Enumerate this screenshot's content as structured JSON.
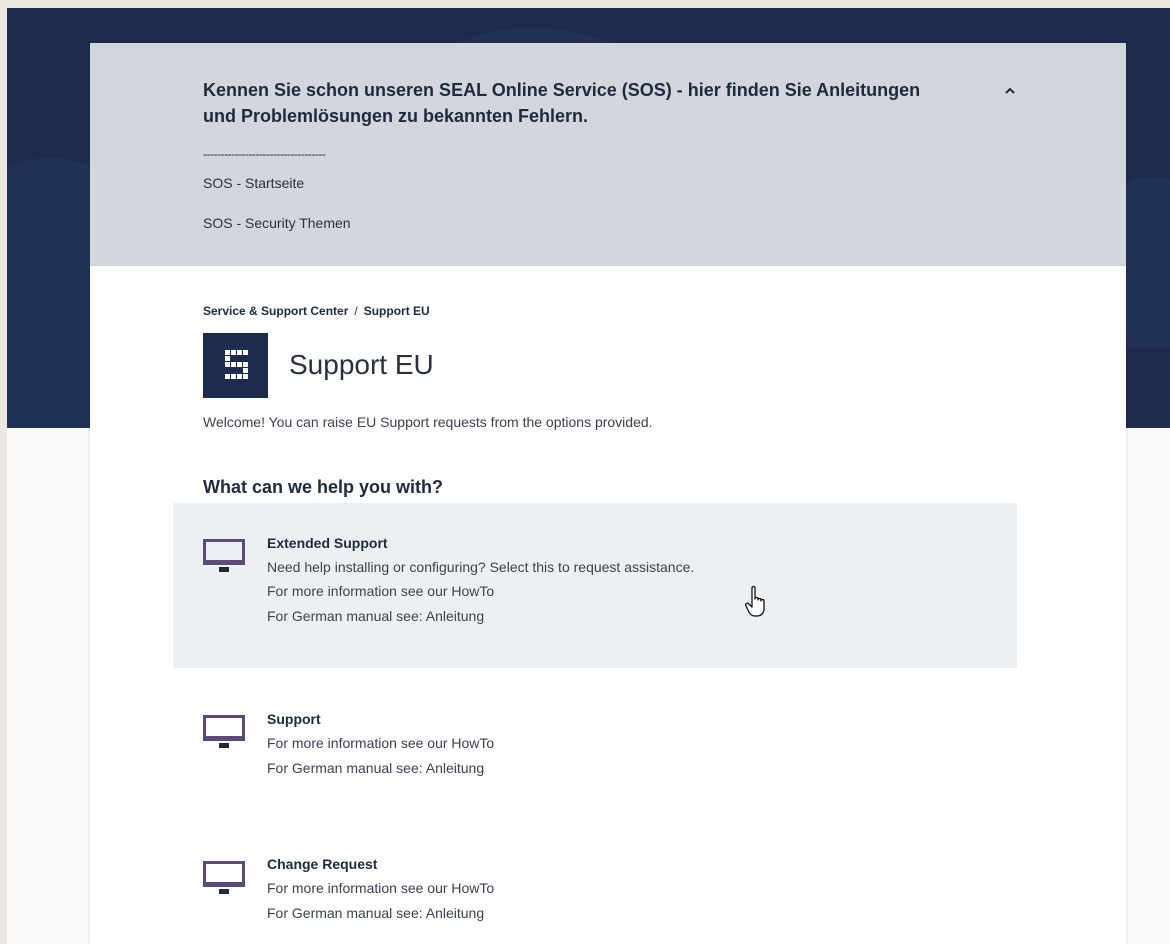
{
  "banner": {
    "title": "Kennen Sie schon unseren SEAL Online Service (SOS) - hier finden Sie Anleitungen und Problemlösungen zu bekannten Fehlern.",
    "collapse_icon": "chevron-up-icon",
    "divider": "-----------------------------------",
    "links": [
      "SOS - Startseite",
      "SOS - Security Themen"
    ]
  },
  "breadcrumb": {
    "items": [
      "Service & Support Center",
      "Support EU"
    ],
    "separator": "/"
  },
  "portal": {
    "logo_icon": "seal-logo-icon",
    "title": "Support EU",
    "welcome": "Welcome! You can raise EU Support requests from the options provided."
  },
  "section": {
    "heading": "What can we help you with?"
  },
  "options": [
    {
      "icon": "monitor-icon",
      "title": "Extended Support",
      "description": "Need help installing or configuring? Select this to request assistance.",
      "howto_prefix": "For more information see our ",
      "howto_link": "HowTo",
      "manual_prefix": "For German manual see: ",
      "manual_link": "Anleitung"
    },
    {
      "icon": "monitor-icon",
      "title": "Support",
      "howto_prefix": "For more information see our ",
      "howto_link": "HowTo",
      "manual_prefix": "For German manual see: ",
      "manual_link": "Anleitung"
    },
    {
      "icon": "monitor-icon",
      "title": "Change Request",
      "howto_prefix": "For more information see our ",
      "howto_link": "HowTo",
      "manual_prefix": "For German manual see: ",
      "manual_link": "Anleitung"
    }
  ],
  "colors": {
    "hero": "#1d2b4e",
    "banner": "#d3d6dc",
    "icon_accent": "#5b4a7a",
    "highlight": "#edf0f2"
  }
}
